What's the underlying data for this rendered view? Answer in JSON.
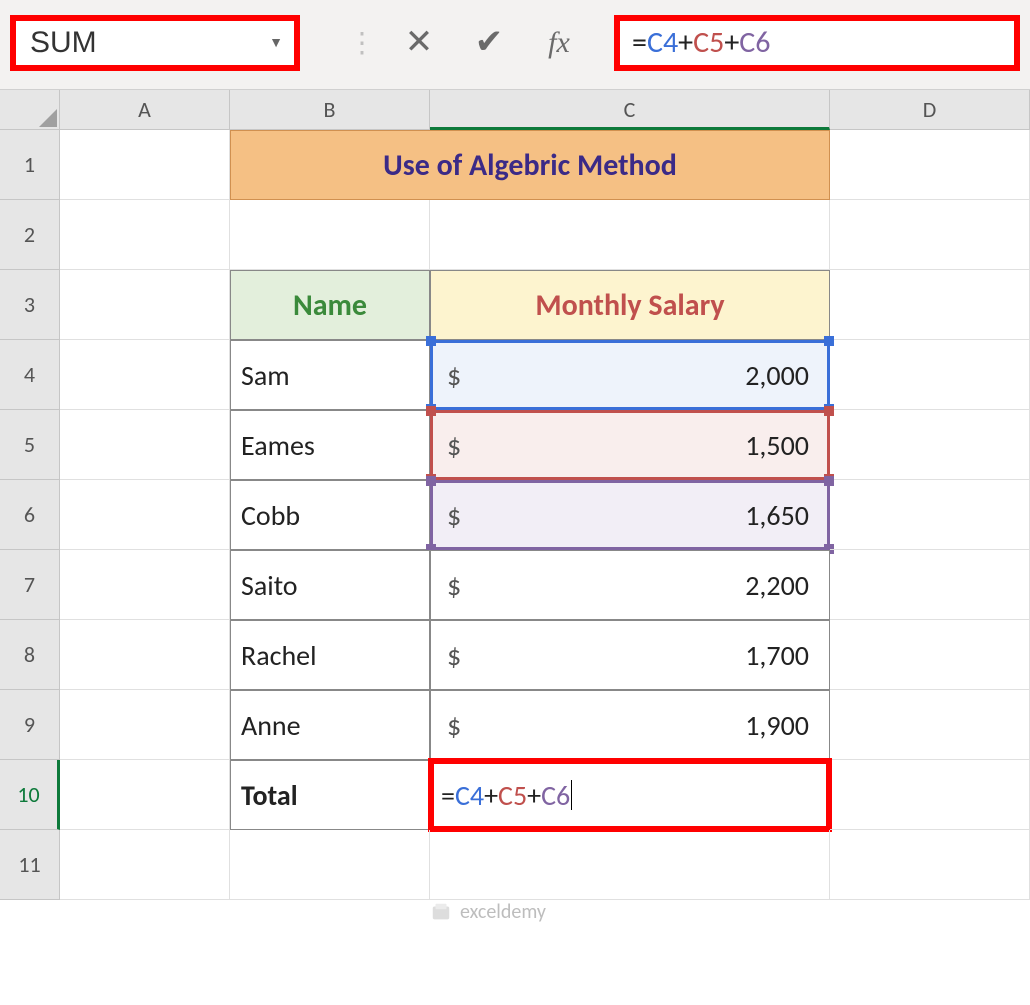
{
  "name_box": "SUM",
  "formula_bar": {
    "cancel_glyph": "✕",
    "enter_glyph": "✔",
    "fx_label": "fx",
    "eq": "=",
    "ref1": "C4",
    "plus": "+",
    "ref2": "C5",
    "ref3": "C6"
  },
  "columns": {
    "A": "A",
    "B": "B",
    "C": "C",
    "D": "D"
  },
  "rows": {
    "r1": "1",
    "r2": "2",
    "r3": "3",
    "r4": "4",
    "r5": "5",
    "r6": "6",
    "r7": "7",
    "r8": "8",
    "r9": "9",
    "r10": "10",
    "r11": "11"
  },
  "title": "Use of Algebric Method",
  "headers": {
    "name": "Name",
    "salary": "Monthly Salary"
  },
  "data": [
    {
      "name": "Sam",
      "currency": "$",
      "salary": "2,000"
    },
    {
      "name": "Eames",
      "currency": "$",
      "salary": "1,500"
    },
    {
      "name": "Cobb",
      "currency": "$",
      "salary": "1,650"
    },
    {
      "name": "Saito",
      "currency": "$",
      "salary": "2,200"
    },
    {
      "name": "Rachel",
      "currency": "$",
      "salary": "1,700"
    },
    {
      "name": "Anne",
      "currency": "$",
      "salary": "1,900"
    }
  ],
  "total_label": "Total",
  "active_formula": {
    "eq": "=",
    "c4": "C4",
    "p": "+",
    "c5": "C5",
    "c6": "C6"
  },
  "watermark": "exceldemy"
}
